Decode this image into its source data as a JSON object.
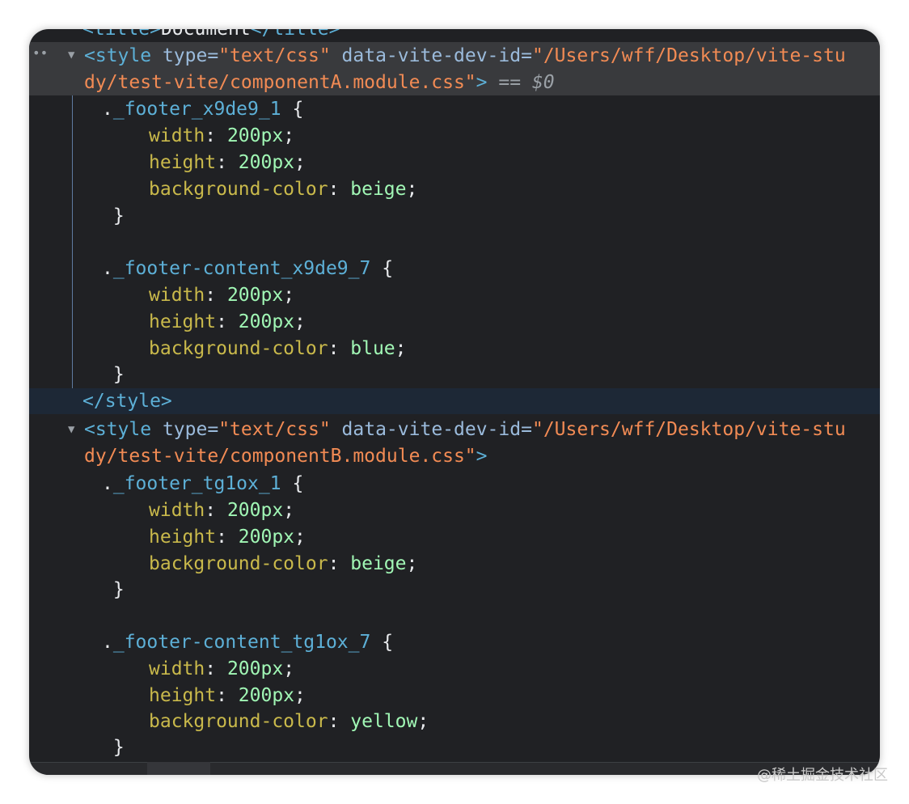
{
  "title_line": {
    "open": "<title>",
    "text": "Document",
    "close": "</title>"
  },
  "styleA": {
    "open": "<style",
    "attr1": "type",
    "val1": "\"text/css\"",
    "attr2": "data-vite-dev-id",
    "val2_part1": "\"/Users/wff/Desktop/vite-stu",
    "val2_part2": "dy/test-vite/componentA.module.css\"",
    "gt": ">",
    "eq_marker": "==",
    "dollar_marker": "$0",
    "rules": [
      {
        "selector": "._footer_x9de9_1",
        "decls": [
          {
            "prop": "width",
            "value": "200px"
          },
          {
            "prop": "height",
            "value": "200px"
          },
          {
            "prop": "background-color",
            "value": "beige"
          }
        ]
      },
      {
        "selector": "._footer-content_x9de9_7",
        "decls": [
          {
            "prop": "width",
            "value": "200px"
          },
          {
            "prop": "height",
            "value": "200px"
          },
          {
            "prop": "background-color",
            "value": "blue"
          }
        ]
      }
    ],
    "close": "</style>"
  },
  "styleB": {
    "open": "<style",
    "attr1": "type",
    "val1": "\"text/css\"",
    "attr2": "data-vite-dev-id",
    "val2_part1": "\"/Users/wff/Desktop/vite-stu",
    "val2_part2": "dy/test-vite/componentB.module.css\"",
    "gt": ">",
    "rules": [
      {
        "selector": "._footer_tg1ox_1",
        "decls": [
          {
            "prop": "width",
            "value": "200px"
          },
          {
            "prop": "height",
            "value": "200px"
          },
          {
            "prop": "background-color",
            "value": "beige"
          }
        ]
      },
      {
        "selector": "._footer-content_tg1ox_7",
        "decls": [
          {
            "prop": "width",
            "value": "200px"
          },
          {
            "prop": "height",
            "value": "200px"
          },
          {
            "prop": "background-color",
            "value": "yellow"
          }
        ]
      }
    ]
  },
  "icons": {
    "expand": "triangle-down",
    "more": "ellipsis"
  },
  "colors": {
    "tag": "#5db0d7",
    "attribute": "#9bbbdc",
    "string": "#f28b54",
    "property": "#c9b94b",
    "value": "#a1f7b5",
    "background": "#202124"
  },
  "watermark": "@稀土掘金技术社区"
}
